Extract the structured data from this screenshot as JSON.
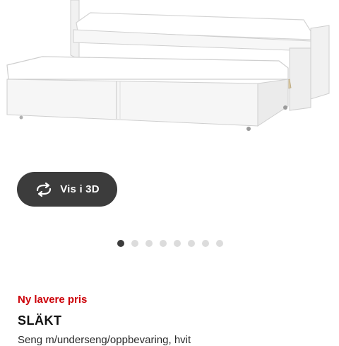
{
  "product_image": {
    "alt": "",
    "icon": "bed-with-pull-out-underbed"
  },
  "view_3d_button": {
    "label": "Vis i 3D",
    "icon": "rotate-3d-icon"
  },
  "carousel": {
    "total": 8,
    "active_index": 0
  },
  "badge": {
    "text": "Ny lavere pris",
    "color": "#cc0008"
  },
  "product": {
    "name": "SLÄKT",
    "description": "Seng m/underseng/oppbevaring, hvit"
  },
  "colors": {
    "button_bg": "#3c3c3c",
    "dot_active": "#3c3c3c",
    "dot_inactive": "#dcdcdc"
  }
}
